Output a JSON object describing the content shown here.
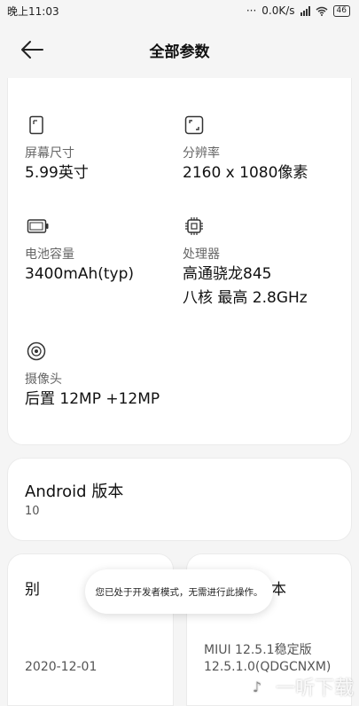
{
  "statusbar": {
    "time": "晚上11:03",
    "speed": "0.0K/s",
    "battery": "46"
  },
  "header": {
    "title": "全部参数",
    "back_icon": "arrow-left-icon"
  },
  "specs": [
    {
      "icon": "screen-icon",
      "label": "屏幕尺寸",
      "value": "5.99英寸"
    },
    {
      "icon": "resolution-icon",
      "label": "分辨率",
      "value": "2160 x 1080像素"
    },
    {
      "icon": "battery-icon",
      "label": "电池容量",
      "value": "3400mAh(typ)"
    },
    {
      "icon": "processor-icon",
      "label": "处理器",
      "value": "高通骁龙845",
      "value2": "八核 最高 2.8GHz"
    },
    {
      "icon": "camera-icon",
      "label": "摄像头",
      "value": "后置 12MP +12MP"
    }
  ],
  "android": {
    "title": "Android 版本",
    "version": "10"
  },
  "bottom_cards": [
    {
      "label": "别",
      "value": "2020-12-01"
    },
    {
      "label": "本",
      "value": "MIUI 12.5.1稳定版",
      "value2": "12.5.1.0(QDGCNXM)"
    }
  ],
  "toast": "您已处于开发者模式，无需进行此操作。",
  "watermark": "一听下载"
}
